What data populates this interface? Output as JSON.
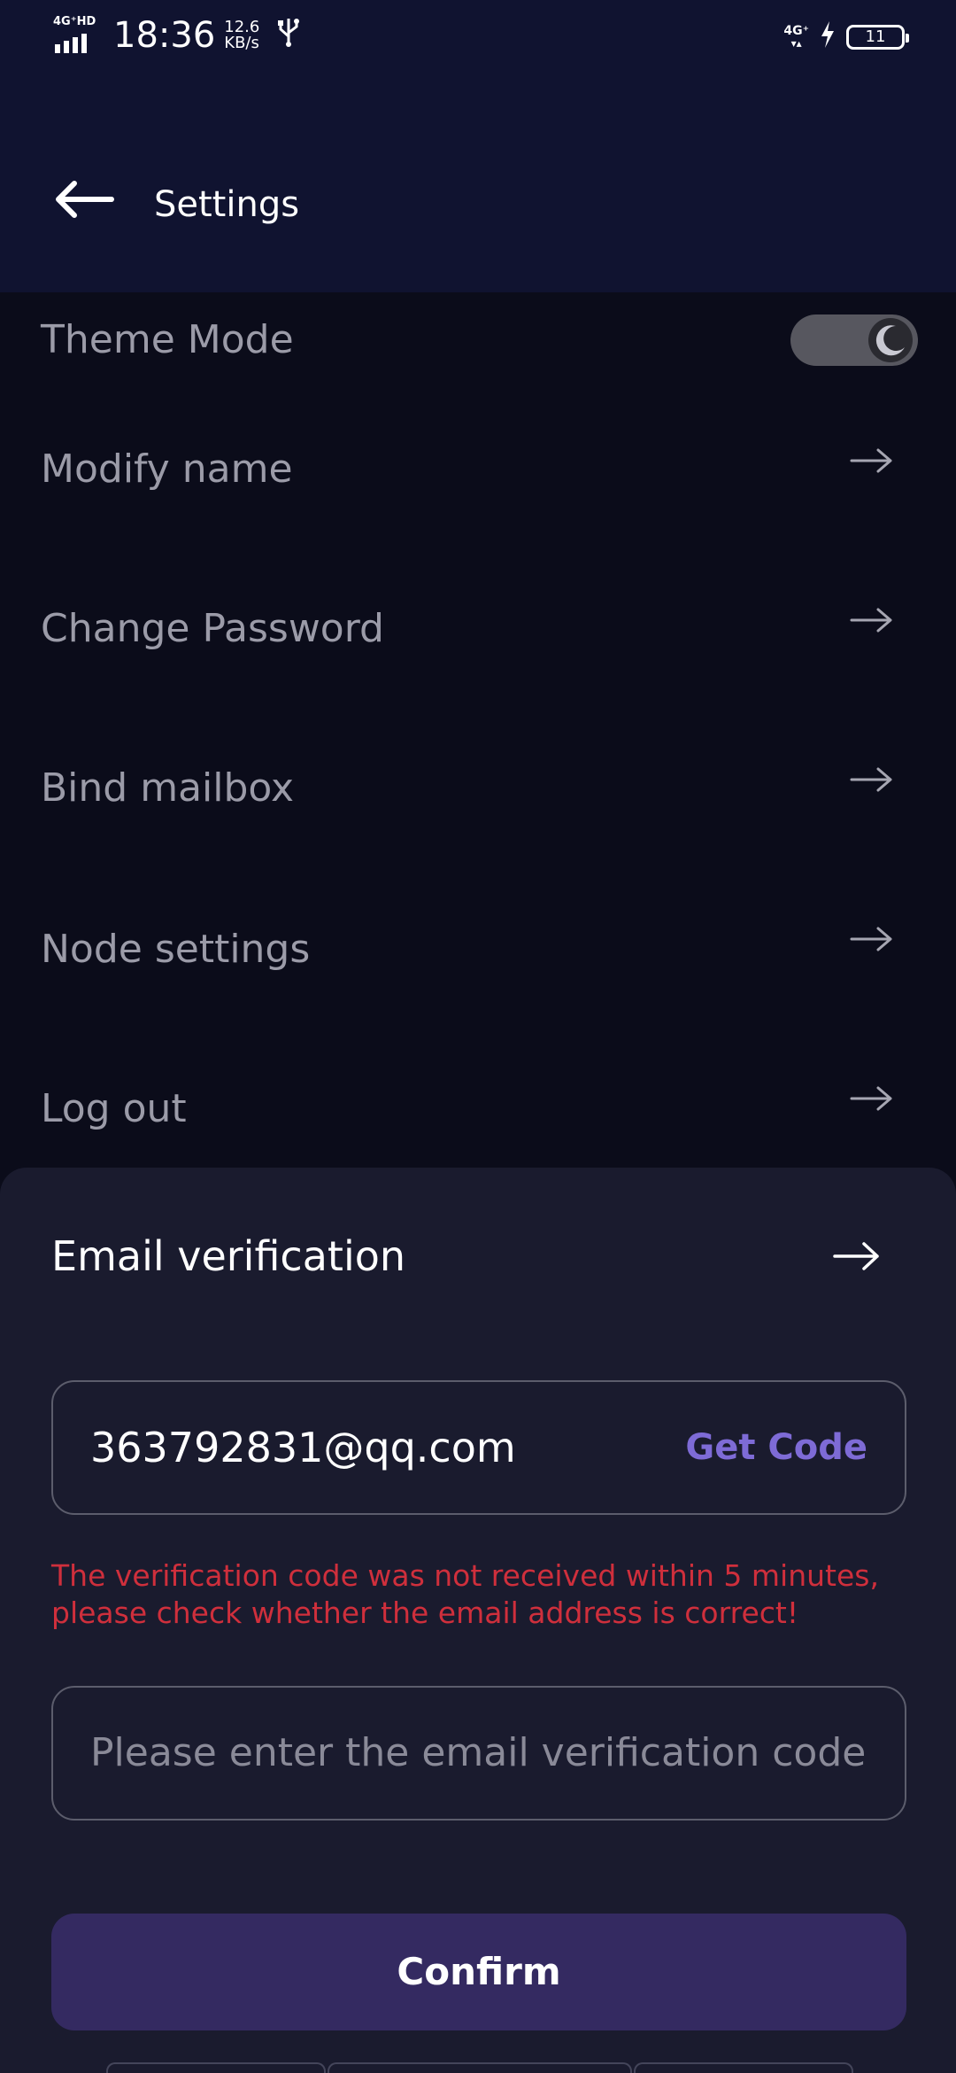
{
  "status_bar": {
    "network_label": "4G⁺HD",
    "time": "18:36",
    "speed_value": "12.6",
    "speed_unit": "KB/s",
    "right_network_label": "4G⁺",
    "battery_level": "11"
  },
  "header": {
    "title": "Settings",
    "back_icon": "arrow-left-icon"
  },
  "settings": {
    "theme_mode": {
      "label": "Theme Mode",
      "dark_mode_on": true,
      "knob_icon": "moon-icon"
    },
    "items": [
      {
        "label": "Modify name",
        "icon": "arrow-right-icon"
      },
      {
        "label": "Change Password",
        "icon": "arrow-right-icon"
      },
      {
        "label": "Bind mailbox",
        "icon": "arrow-right-icon"
      },
      {
        "label": "Node settings",
        "icon": "arrow-right-icon"
      },
      {
        "label": "Log out",
        "icon": "arrow-right-icon"
      }
    ]
  },
  "email_sheet": {
    "title": "Email verification",
    "email_value": "363792831@qq.com",
    "get_code_label": "Get Code",
    "error_message": "The verification code was not received within 5 minutes, please check whether the email address is correct!",
    "code_placeholder": "Please enter the email verification code",
    "confirm_label": "Confirm"
  },
  "colors": {
    "header_bg": "#101330",
    "page_bg": "#0b0c1a",
    "sheet_bg": "#1a1b2e",
    "accent": "#7e6bd6",
    "error": "#cf2f3c",
    "button_bg": "#342a61"
  }
}
